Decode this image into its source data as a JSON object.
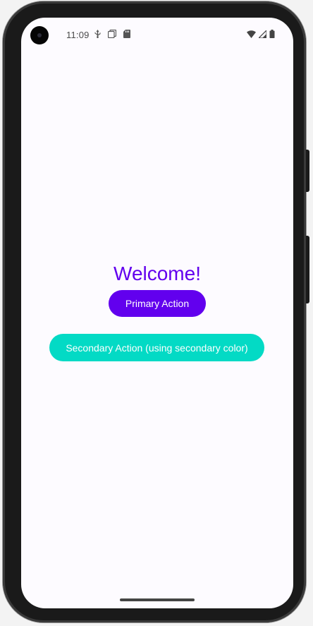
{
  "status_bar": {
    "time": "11:09",
    "left_icons": [
      "usb-debug-icon",
      "sim-icon",
      "sd-card-icon"
    ],
    "right_icons": [
      "wifi-icon",
      "signal-icon",
      "battery-icon"
    ]
  },
  "main": {
    "welcome_text": "Welcome!",
    "primary_button_label": "Primary Action",
    "secondary_button_label": "Secondary Action (using secondary color)"
  },
  "colors": {
    "primary": "#6200ee",
    "secondary": "#03dac5",
    "background": "#fdfbff"
  }
}
